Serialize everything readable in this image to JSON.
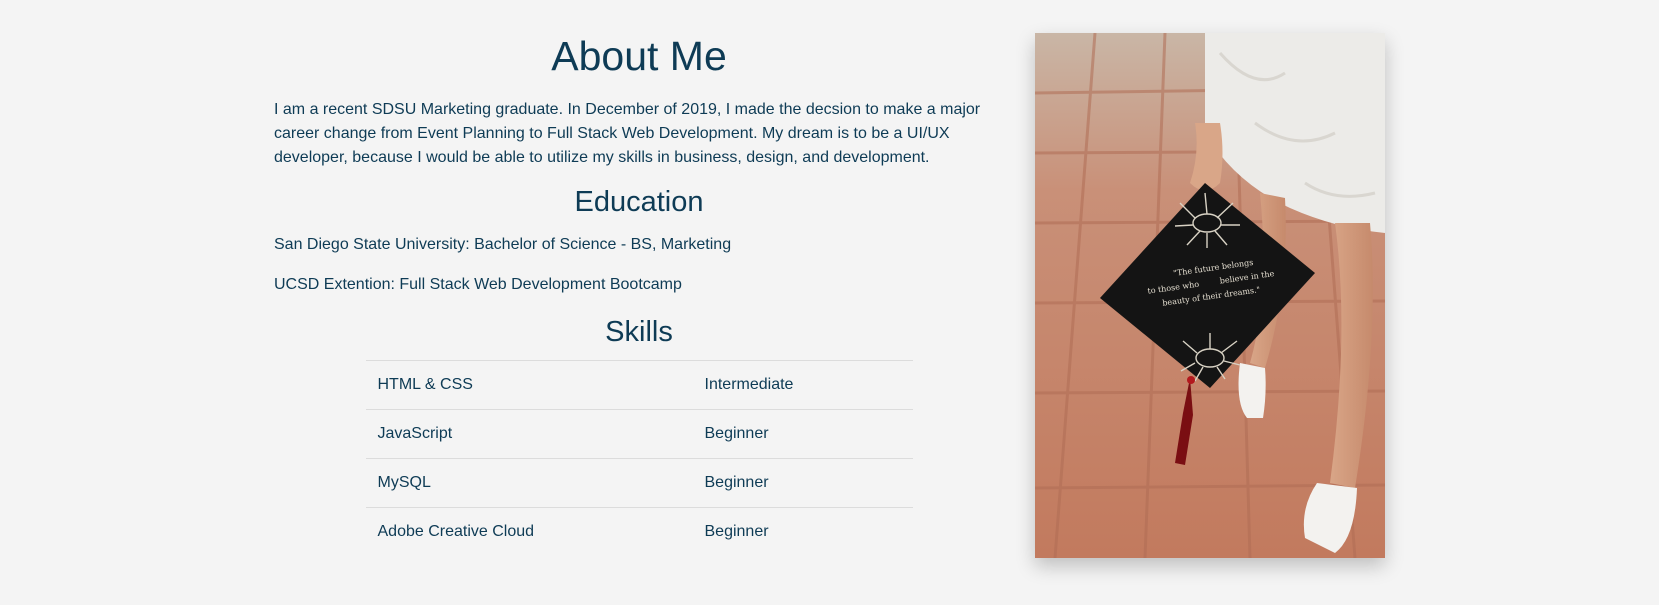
{
  "about": {
    "title": "About Me",
    "bio": "I am a recent SDSU Marketing graduate. In December of 2019, I made the decsion to make a major career change from Event Planning to Full Stack Web Development. My dream is to be a UI/UX developer, because I would be able to utilize my skills in business, design, and development."
  },
  "education": {
    "title": "Education",
    "items": [
      "San Diego State University: Bachelor of Science - BS, Marketing",
      "UCSD Extention: Full Stack Web Development Bootcamp"
    ]
  },
  "skills": {
    "title": "Skills",
    "rows": [
      {
        "skill": "HTML & CSS",
        "level": "Intermediate"
      },
      {
        "skill": "JavaScript",
        "level": "Beginner"
      },
      {
        "skill": "MySQL",
        "level": "Beginner"
      },
      {
        "skill": "Adobe Creative Cloud",
        "level": "Beginner"
      }
    ]
  },
  "photo": {
    "cap_quote_line1": "\"The future belongs",
    "cap_quote_line2": "to those who",
    "cap_quote_line2b": "believe in the",
    "cap_quote_line3": "beauty of their dreams.\""
  },
  "colors": {
    "text": "#0e3b55",
    "background": "#f4f4f4",
    "divider": "#dcdcdc"
  }
}
